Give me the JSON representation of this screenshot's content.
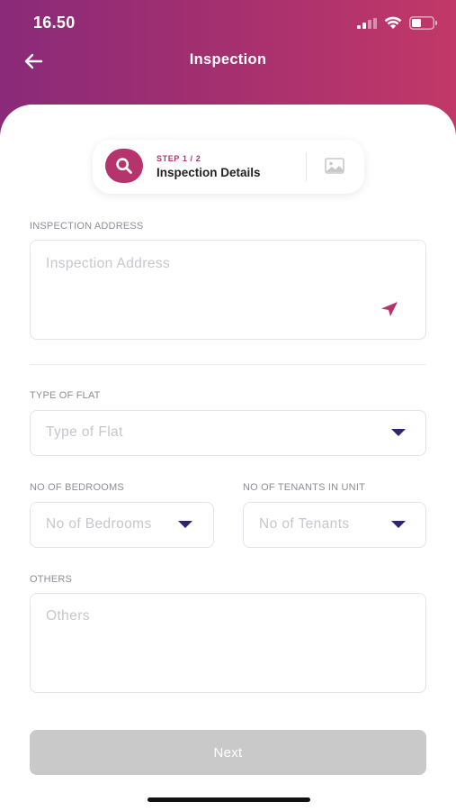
{
  "status_bar": {
    "time": "16.50"
  },
  "nav": {
    "title": "Inspection"
  },
  "stepper": {
    "step_count": "STEP 1 / 2",
    "step_title": "Inspection Details"
  },
  "form": {
    "address": {
      "label": "INSPECTION ADDRESS",
      "placeholder": "Inspection Address"
    },
    "flat_type": {
      "label": "TYPE OF FLAT",
      "placeholder": "Type of Flat"
    },
    "bedrooms": {
      "label": "NO OF BEDROOMS",
      "placeholder": "No of Bedrooms"
    },
    "tenants": {
      "label": "NO OF TENANTS IN UNIT",
      "placeholder": "No of Tenants"
    },
    "others": {
      "label": "OTHERS",
      "placeholder": "Others"
    }
  },
  "actions": {
    "next_label": "Next"
  },
  "colors": {
    "accent": "#b5346d",
    "header_start": "#8a2a79",
    "header_end": "#c23868",
    "dropdown_caret": "#2d2570",
    "button_disabled": "#c9c9ca"
  },
  "icons": [
    "cellular-signal-icon",
    "wifi-icon",
    "battery-icon",
    "back-arrow-icon",
    "search-icon",
    "image-icon",
    "location-arrow-icon",
    "chevron-down-icon"
  ]
}
